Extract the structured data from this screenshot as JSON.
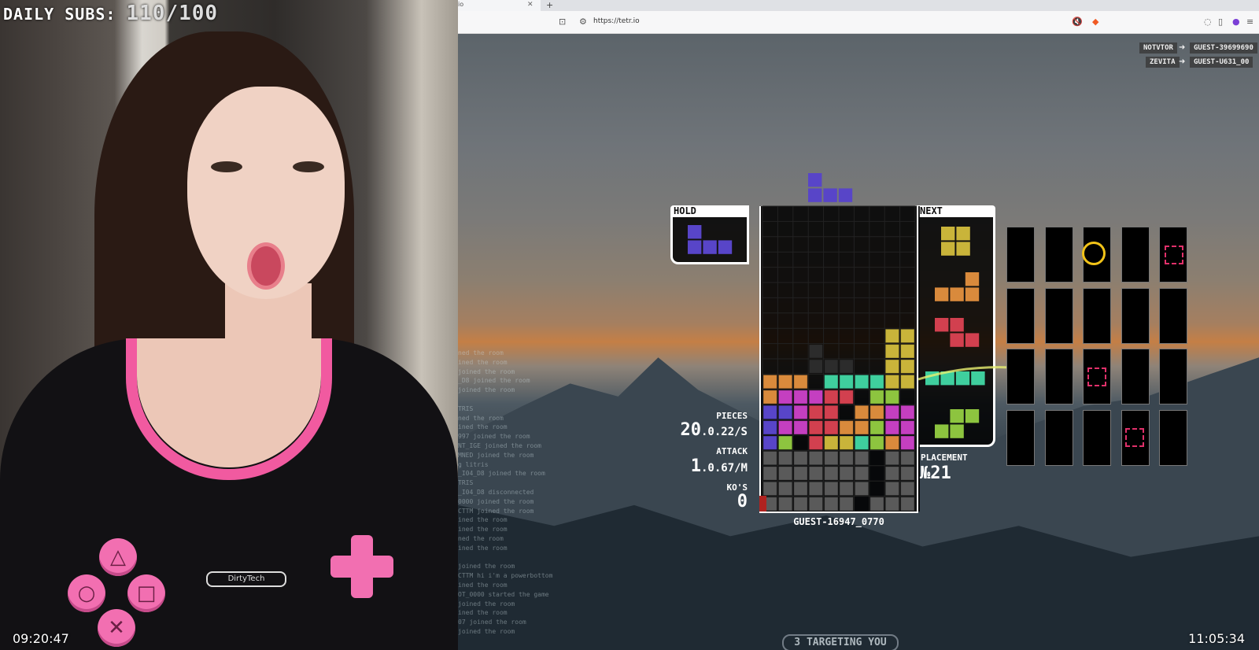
{
  "overlay": {
    "daily_subs_label": "DAILY SUBS:",
    "daily_subs_value": "110/100",
    "clock_left": "09:20:47",
    "clock_right": "11:05:34"
  },
  "browser": {
    "tab_title": "io",
    "url": "https://tetr.io",
    "icons": [
      "bookmark-icon",
      "site-info-icon",
      "mute-icon",
      "brave-shield-icon",
      "chat-icon",
      "sidebar-icon",
      "profile-icon",
      "menu-icon"
    ]
  },
  "game": {
    "hold_label": "HOLD",
    "next_label": "NEXT",
    "stats": {
      "pieces_label": "PIECES",
      "pieces_value": "20",
      "pieces_rate": ".0.22/S",
      "attack_label": "ATTACK",
      "attack_value": "1",
      "attack_rate": ".0.67/M",
      "kos_label": "KO'S",
      "kos_value": "0"
    },
    "placement_label": "PLACEMENT",
    "placement_value": "№21",
    "player_name": "GUEST-16947_0770",
    "targeting_text": "3 TARGETING YOU",
    "killfeed": [
      {
        "from": "NOTVTOR",
        "to": "GUEST-39699690"
      },
      {
        "from": "ZEVITA",
        "to": "GUEST-U631_00"
      }
    ],
    "colors": {
      "T": "#c43fc0",
      "I": "#3fcf9e",
      "O": "#c9b43a",
      "L": "#d98a3c",
      "J": "#5845c8",
      "S": "#8dc43f",
      "Z": "#d2404f",
      "G": "#666666",
      "X": "#2a2a2a"
    }
  },
  "chat_lines": [
    "ned the room",
    "ined the room",
    "joined the room",
    "_D8 joined the room",
    "joined the room",
    "",
    "TRIS",
    "ned the room",
    "ined the room",
    "997 joined the room",
    "NT_IGE joined the room",
    "MNED joined the room",
    "g litris",
    "_I04_D8 joined the room",
    "TRIS",
    "_I04_D8 disconnected",
    "0000 joined the room",
    "CTTM joined the room",
    "ined the room",
    "ined the room",
    "ned the room",
    "ined the room",
    "",
    "joined the room",
    "CTTM hi i'm a powerbottom",
    "ined the room",
    "OT_0000 started the game",
    "joined the room",
    "ined the room",
    "07 joined the room",
    "joined the room"
  ]
}
